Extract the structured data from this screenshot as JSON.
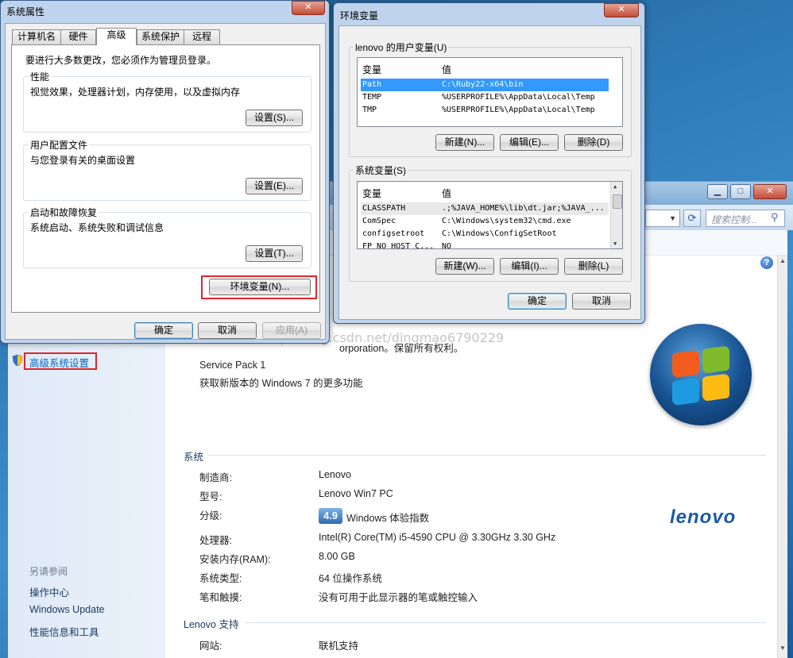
{
  "control_panel": {
    "search_placeholder": "搜索控制...",
    "left_links": {
      "advanced_settings": "高级系统设置",
      "see_also": "另请参阅",
      "items": [
        "操作中心",
        "Windows Update",
        "性能信息和工具"
      ]
    },
    "edition": {
      "copyright_partial": "orporation。保留所有权利。",
      "service_pack": "Service Pack 1",
      "more_features_link": "获取新版本的 Windows 7 的更多功能"
    },
    "system_section": {
      "title": "系统",
      "rows": [
        {
          "label": "制造商:",
          "value": "Lenovo"
        },
        {
          "label": "型号:",
          "value": "Lenovo Win7 PC"
        },
        {
          "label": "分级:",
          "value": "Windows 体验指数"
        },
        {
          "label": "处理器:",
          "value": "Intel(R) Core(TM) i5-4590 CPU @ 3.30GHz   3.30 GHz"
        },
        {
          "label": "安装内存(RAM):",
          "value": "8.00 GB"
        },
        {
          "label": "系统类型:",
          "value": "64 位操作系统"
        },
        {
          "label": "笔和触摸:",
          "value": "没有可用于此显示器的笔或触控输入"
        }
      ],
      "rating_score": "4.9"
    },
    "lenovo_section": {
      "title": "Lenovo 支持",
      "website_label": "网站:",
      "website_link": "联机支持"
    },
    "lenovo_logo_text": "lenovo",
    "help_icon_glyph": "?"
  },
  "watermark": "http://blog.csdn.net/dingmao6790229",
  "system_properties": {
    "title": "系统属性",
    "tabs": [
      "计算机名",
      "硬件",
      "高级",
      "系统保护",
      "远程"
    ],
    "active_tab": "高级",
    "admin_note": "要进行大多数更改，您必须作为管理员登录。",
    "groups": [
      {
        "title": "性能",
        "desc": "视觉效果，处理器计划，内存使用，以及虚拟内存",
        "button": "设置(S)..."
      },
      {
        "title": "用户配置文件",
        "desc": "与您登录有关的桌面设置",
        "button": "设置(E)..."
      },
      {
        "title": "启动和故障恢复",
        "desc": "系统启动、系统失败和调试信息",
        "button": "设置(T)..."
      }
    ],
    "env_button": "环境变量(N)...",
    "ok": "确定",
    "cancel": "取消",
    "apply": "应用(A)"
  },
  "env_vars": {
    "title": "环境变量",
    "user_group_title": "lenovo 的用户变量(U)",
    "system_group_title": "系统变量(S)",
    "col_var": "变量",
    "col_val": "值",
    "user_rows": [
      {
        "name": "Path",
        "value": "C:\\Ruby22-x64\\bin",
        "selected": true
      },
      {
        "name": "TEMP",
        "value": "%USERPROFILE%\\AppData\\Local\\Temp",
        "selected": false
      },
      {
        "name": "TMP",
        "value": "%USERPROFILE%\\AppData\\Local\\Temp",
        "selected": false
      }
    ],
    "system_rows": [
      {
        "name": "CLASSPATH",
        "value": ".;%JAVA_HOME%\\lib\\dt.jar;%JAVA_..."
      },
      {
        "name": "ComSpec",
        "value": "C:\\Windows\\system32\\cmd.exe"
      },
      {
        "name": "configsetroot",
        "value": "C:\\Windows\\ConfigSetRoot"
      },
      {
        "name": "FP_NO_HOST_C...",
        "value": "NO"
      }
    ],
    "user_buttons": {
      "new": "新建(N)...",
      "edit": "编辑(E)...",
      "delete": "删除(D)"
    },
    "system_buttons": {
      "new": "新建(W)...",
      "edit": "编辑(I)...",
      "delete": "删除(L)"
    },
    "ok": "确定",
    "cancel": "取消"
  },
  "window_controls": {
    "minimize": "▁",
    "maximize": "□",
    "close": "✕"
  },
  "colors": {
    "accent_link": "#0066cc",
    "highlight_red": "#e0262b",
    "selection": "#3399ff"
  }
}
